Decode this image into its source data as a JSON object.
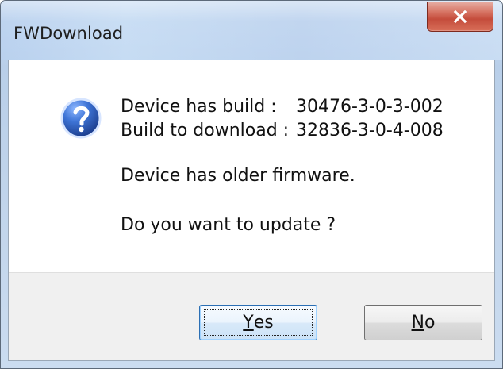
{
  "window": {
    "title": "FWDownload"
  },
  "message": {
    "device_build_label": "Device has build :",
    "device_build_value": "30476-3-0-3-002",
    "download_build_label": "Build to download :",
    "download_build_value": "32836-3-0-4-008",
    "status": "Device has older firmware.",
    "question": "Do you want to update ?"
  },
  "buttons": {
    "yes_first": "Y",
    "yes_rest": "es",
    "no_first": "N",
    "no_rest": "o"
  },
  "icons": {
    "close": "close-icon",
    "question": "question-icon"
  },
  "colors": {
    "close_button": "#c94c3b",
    "question_icon": "#2d5fb8",
    "default_button_border": "#2b6fb4"
  }
}
